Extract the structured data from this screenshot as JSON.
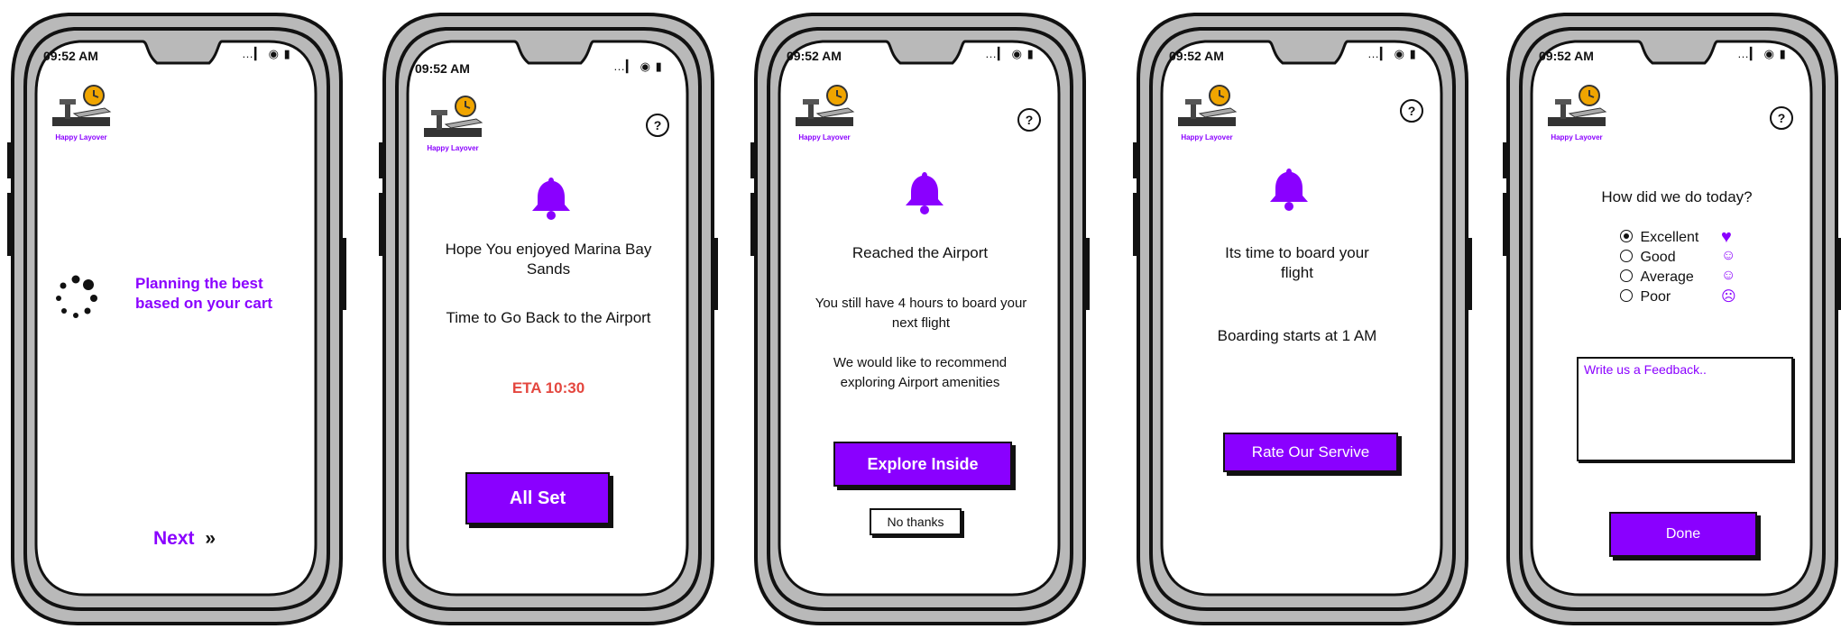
{
  "app": {
    "name": "Happy Layover",
    "time": "09:52 AM",
    "status_icons": "…▎ ◉ ▮"
  },
  "screens": [
    {
      "planning": "Planning the best based on your cart",
      "next": "Next",
      "next_icon": "»"
    },
    {
      "line1": "Hope You enjoyed Marina Bay Sands",
      "line2": "Time to Go Back to the Airport",
      "eta": "ETA 10:30",
      "button": "All Set"
    },
    {
      "line1": "Reached the Airport",
      "line2": "You still have 4 hours to board your next flight",
      "line3": "We would like to recommend exploring Airport amenities",
      "button": "Explore Inside",
      "secondary": "No thanks"
    },
    {
      "line1": "Its time to board your flight",
      "line2": "Boarding starts at 1 AM",
      "button": "Rate Our Servive"
    },
    {
      "question": "How did we do today?",
      "options": [
        {
          "label": "Excellent",
          "selected": true,
          "icon": "heart-icon"
        },
        {
          "label": "Good",
          "selected": false,
          "icon": "smile-icon"
        },
        {
          "label": "Average",
          "selected": false,
          "icon": "neutral-face-icon"
        },
        {
          "label": "Poor",
          "selected": false,
          "icon": "sad-face-icon"
        }
      ],
      "feedback_placeholder": "Write us a Feedback..",
      "button": "Done"
    }
  ],
  "colors": {
    "accent": "#8a00ff",
    "eta": "#e4473f",
    "frame": "#b9b9b9"
  }
}
